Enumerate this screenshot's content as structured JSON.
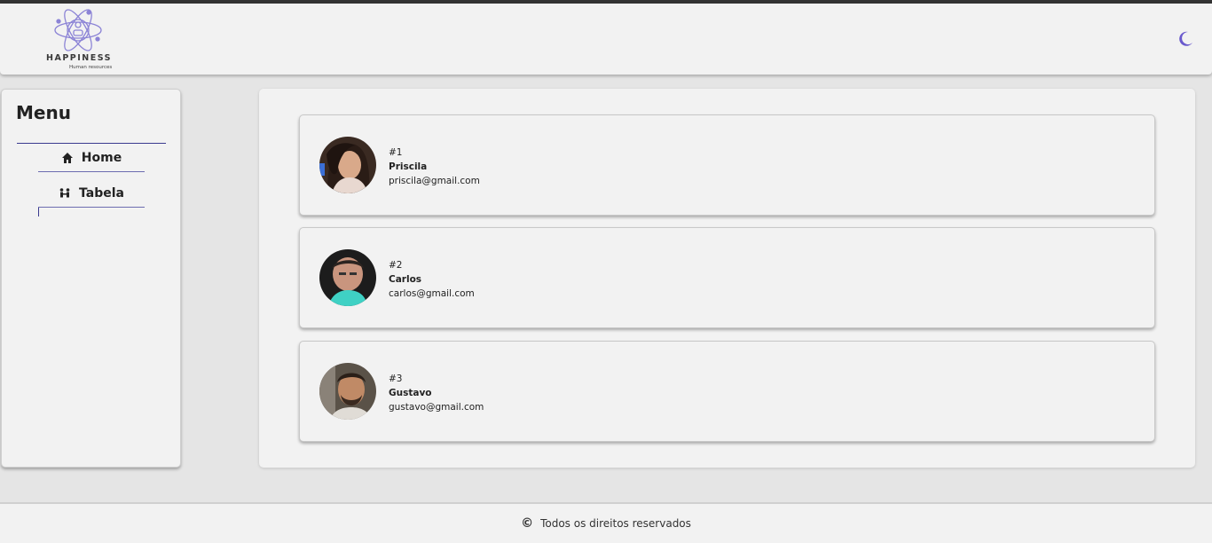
{
  "header": {
    "logo_text": "HAPPINESS",
    "logo_subtext": "Human resources",
    "theme_toggle_icon": "moon-icon",
    "accent_color": "#6a5acd"
  },
  "sidebar": {
    "title": "Menu",
    "items": [
      {
        "label": "Home",
        "icon": "home-icon"
      },
      {
        "label": "Tabela",
        "icon": "people-icon"
      }
    ]
  },
  "employees": [
    {
      "id": "#1",
      "name": "Priscila",
      "email": "priscila@gmail.com"
    },
    {
      "id": "#2",
      "name": "Carlos",
      "email": "carlos@gmail.com"
    },
    {
      "id": "#3",
      "name": "Gustavo",
      "email": "gustavo@gmail.com"
    }
  ],
  "footer": {
    "icon": "copyright-icon",
    "text": "Todos os direitos reservados"
  }
}
